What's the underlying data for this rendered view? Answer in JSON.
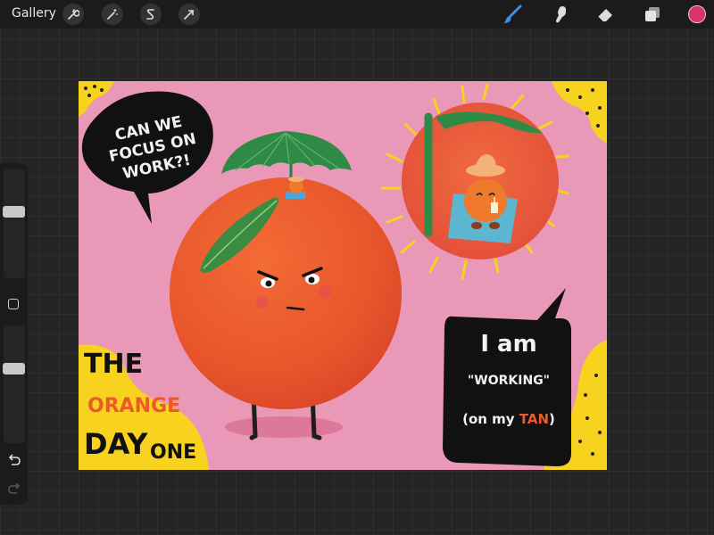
{
  "toolbar": {
    "gallery_label": "Gallery",
    "left_tools": [
      "wrench-icon",
      "magic-wand-icon",
      "selection-icon",
      "transform-arrow-icon"
    ],
    "right_tools": [
      "brush-icon",
      "smudge-icon",
      "eraser-icon",
      "layers-icon"
    ],
    "active_tool": "brush-icon",
    "active_color": "#d9336b"
  },
  "sidebar": {
    "brush_size": 0.62,
    "opacity": 0.65
  },
  "artwork": {
    "bubble_left_text": [
      "CAN WE",
      "FOCUS ON",
      "WORK?!"
    ],
    "title": {
      "line1": "THE",
      "line2": "ORANGE",
      "line3a": "DAY",
      "line3b": "ONE"
    },
    "bubble_right": {
      "line1": "I am",
      "line2": "\"WORKING\"",
      "line3_prefix": "(on my ",
      "line3_highlight": "TAN",
      "line3_suffix": ")"
    },
    "colors": {
      "background": "#ea98b7",
      "orange": "#ec5a2c",
      "accent_yellow": "#f7d21e",
      "bubble": "#111111",
      "leaf": "#2e8a45"
    }
  }
}
